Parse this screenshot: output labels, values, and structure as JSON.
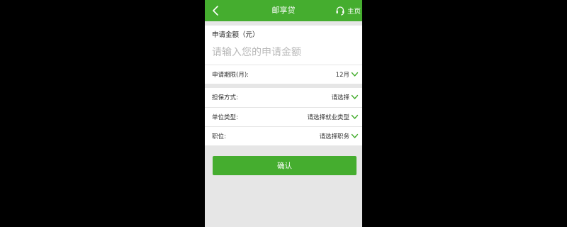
{
  "header": {
    "title": "邮享贷",
    "home_label": "主页",
    "back_icon": "chevron-left-icon",
    "support_icon": "headset-icon",
    "color": "#45ad2f"
  },
  "amount": {
    "label": "申请金额（元）",
    "placeholder": "请输入您的申请金额",
    "value": ""
  },
  "term": {
    "label": "申请期限(月):",
    "value": "12月"
  },
  "fields": [
    {
      "label": "担保方式:",
      "value": "请选择"
    },
    {
      "label": "单位类型:",
      "value": "请选择就业类型"
    },
    {
      "label": "职位:",
      "value": "请选择职务"
    }
  ],
  "confirm_label": "确认",
  "colors": {
    "accent": "#45ad2f",
    "background": "#e6e6e6",
    "placeholder": "#b8b8b8"
  }
}
